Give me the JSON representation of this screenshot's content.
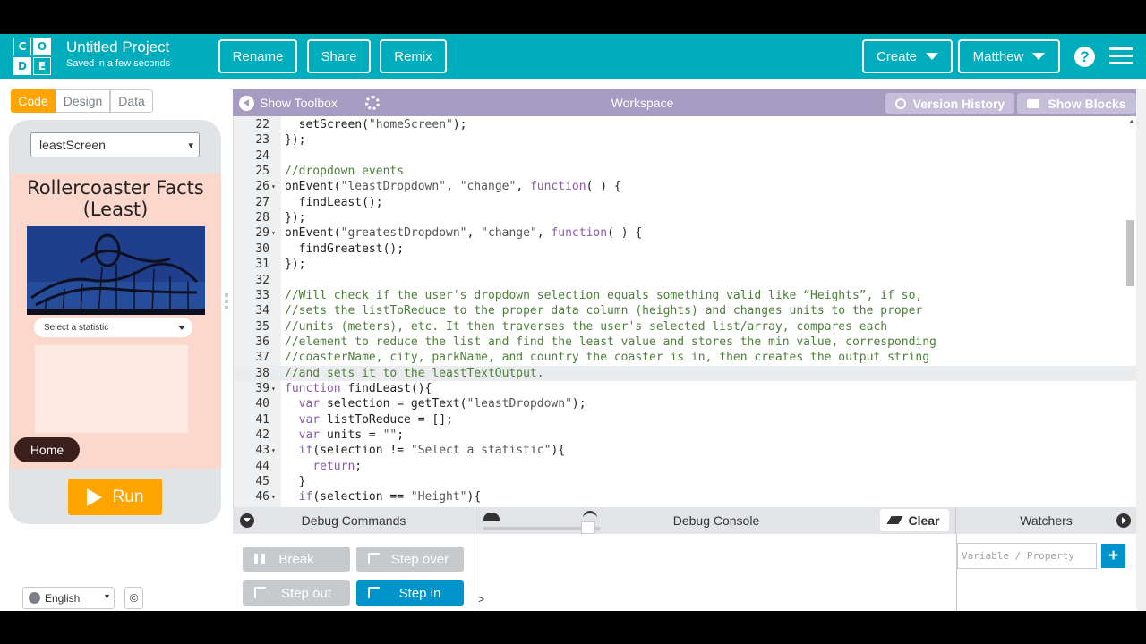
{
  "header": {
    "logo_letters": [
      "C",
      "O",
      "D",
      "E"
    ],
    "project_title": "Untitled Project",
    "saved_status": "Saved in a few seconds",
    "rename_label": "Rename",
    "share_label": "Share",
    "remix_label": "Remix",
    "create_label": "Create",
    "user_label": "Matthew",
    "help_glyph": "?",
    "brand_color": "#00adbc"
  },
  "mode_tabs": {
    "code": "Code",
    "design": "Design",
    "data": "Data",
    "active": "Code",
    "active_color": "#ffa400"
  },
  "app_preview": {
    "screen_select_value": "leastScreen",
    "title": "Rollercoaster Facts (Least)",
    "stat_select_value": "Select a statistic",
    "home_button": "Home",
    "background_color": "#fcd7cc"
  },
  "run_label": "Run",
  "language_value": "English",
  "copyright_glyph": "©",
  "workspace": {
    "toolbox_label": "Show Toolbox",
    "title": "Workspace",
    "version_history_label": "Version History",
    "show_blocks_label": "Show Blocks",
    "bar_color": "#a69bc1"
  },
  "code": {
    "active_line": 38,
    "lines": [
      {
        "n": "22",
        "fold": "",
        "text": "  setScreen(\"homeScreen\");"
      },
      {
        "n": "23",
        "fold": "",
        "text": "});"
      },
      {
        "n": "24",
        "fold": "",
        "text": ""
      },
      {
        "n": "25",
        "fold": "",
        "text": "//dropdown events"
      },
      {
        "n": "26",
        "fold": "▾",
        "text": "onEvent(\"leastDropdown\", \"change\", function( ) {"
      },
      {
        "n": "27",
        "fold": "",
        "text": "  findLeast();"
      },
      {
        "n": "28",
        "fold": "",
        "text": "});"
      },
      {
        "n": "29",
        "fold": "▾",
        "text": "onEvent(\"greatestDropdown\", \"change\", function( ) {"
      },
      {
        "n": "30",
        "fold": "",
        "text": "  findGreatest();"
      },
      {
        "n": "31",
        "fold": "",
        "text": "});"
      },
      {
        "n": "32",
        "fold": "",
        "text": ""
      },
      {
        "n": "33",
        "fold": "",
        "text": "//Will check if the user's dropdown selection equals something valid like “Heights”, if so,"
      },
      {
        "n": "34",
        "fold": "",
        "text": "//sets the listToReduce to the proper data column (heights) and changes units to the proper"
      },
      {
        "n": "35",
        "fold": "",
        "text": "//units (meters), etc. It then traverses the user's selected list/array, compares each"
      },
      {
        "n": "36",
        "fold": "",
        "text": "//element to reduce the list and find the least value and stores the min value, corresponding"
      },
      {
        "n": "37",
        "fold": "",
        "text": "//coasterName, city, parkName, and country the coaster is in, then creates the output string"
      },
      {
        "n": "38",
        "fold": "",
        "text": "//and sets it to the leastTextOutput."
      },
      {
        "n": "39",
        "fold": "▾",
        "text": "function findLeast(){"
      },
      {
        "n": "40",
        "fold": "",
        "text": "  var selection = getText(\"leastDropdown\");"
      },
      {
        "n": "41",
        "fold": "",
        "text": "  var listToReduce = [];"
      },
      {
        "n": "42",
        "fold": "",
        "text": "  var units = \"\";"
      },
      {
        "n": "43",
        "fold": "▾",
        "text": "  if(selection != \"Select a statistic\"){"
      },
      {
        "n": "44",
        "fold": "",
        "text": "    return;"
      },
      {
        "n": "45",
        "fold": "",
        "text": "  }"
      },
      {
        "n": "46",
        "fold": "▾",
        "text": "  if(selection == \"Height\"){"
      }
    ]
  },
  "debug": {
    "commands_title": "Debug Commands",
    "console_title": "Debug Console",
    "clear_label": "Clear",
    "watchers_title": "Watchers",
    "break_label": "Break",
    "step_over_label": "Step over",
    "step_out_label": "Step out",
    "step_in_label": "Step in",
    "console_prompt": ">",
    "watch_placeholder": "Variable / Property",
    "add_glyph": "+",
    "speed_level": 0.9
  }
}
